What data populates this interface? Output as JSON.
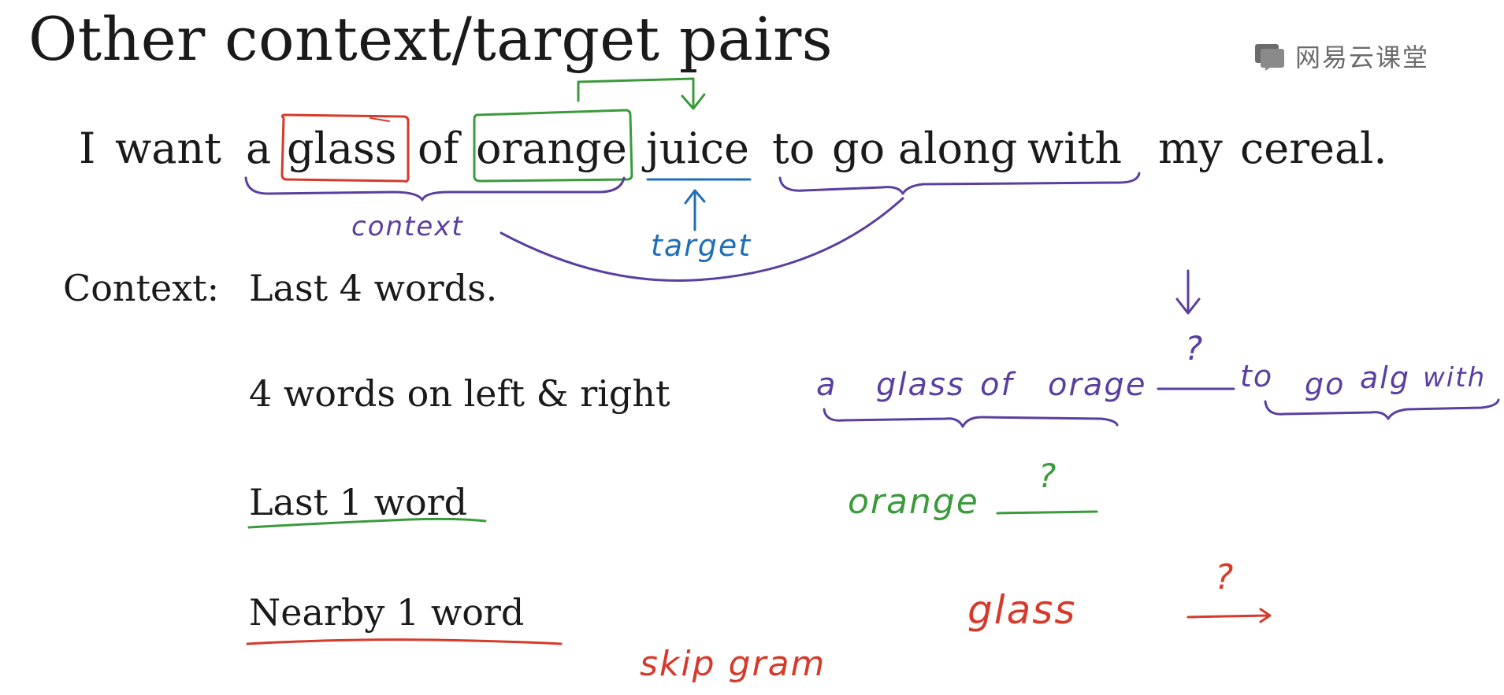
{
  "slide": {
    "title": "Other context/target pairs"
  },
  "watermark": {
    "text": "网易云课堂",
    "icon": "netease-classroom-logo"
  },
  "sentence": {
    "words": [
      "I",
      "want",
      "a",
      "glass",
      "of",
      "orange",
      "juice",
      "to",
      "go",
      "along",
      "with",
      "my",
      "cereal."
    ]
  },
  "annotations": {
    "context": "context",
    "target": "target"
  },
  "context_options": {
    "label": "Context:",
    "items": [
      "Last 4 words.",
      "4 words on left & right",
      "Last 1 word",
      "Nearby 1 word"
    ]
  },
  "handwritten": {
    "example_left": [
      "a",
      "glass",
      "of",
      "orage"
    ],
    "example_right": [
      "to",
      "go",
      "alg",
      "with"
    ],
    "question": "?",
    "orange_word": "orange",
    "glass_word": "glass",
    "skip_gram": "skip gram"
  },
  "colors": {
    "purple": "#5a3fa0",
    "blue": "#1f6fb8",
    "green": "#3b9a3b",
    "red": "#d63a2a",
    "text": "#1a1a1a",
    "watermark": "#6b6b6b"
  }
}
